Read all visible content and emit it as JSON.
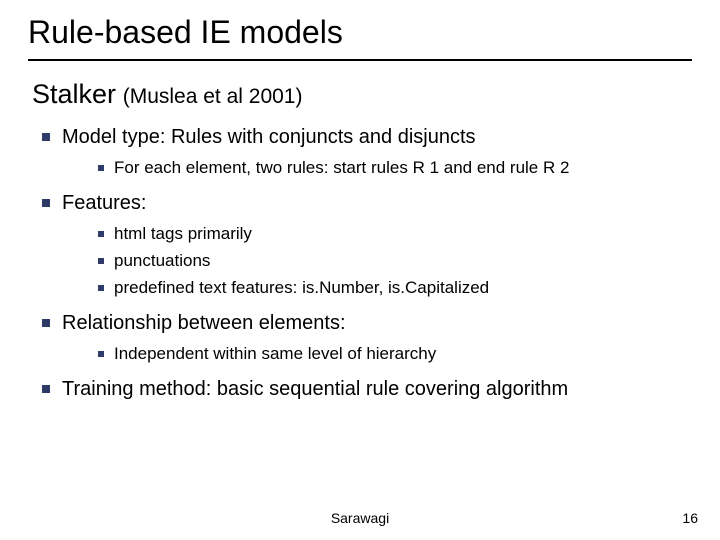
{
  "title": "Rule-based IE models",
  "subtitle": {
    "main": "Stalker",
    "cite": "(Muslea et al 2001)"
  },
  "bullets": {
    "b1": "Model type: Rules with conjuncts and disjuncts",
    "b1_1": "For each element, two rules: start rules R 1 and end rule R 2",
    "b2": "Features:",
    "b2_1": "html tags primarily",
    "b2_2": "punctuations",
    "b2_3": "predefined text features: is.Number, is.Capitalized",
    "b3": "Relationship between elements:",
    "b3_1": "Independent within same level of hierarchy",
    "b4": "Training method:  basic sequential rule covering algorithm"
  },
  "footer": {
    "center": "Sarawagi",
    "pageNumber": "16"
  }
}
